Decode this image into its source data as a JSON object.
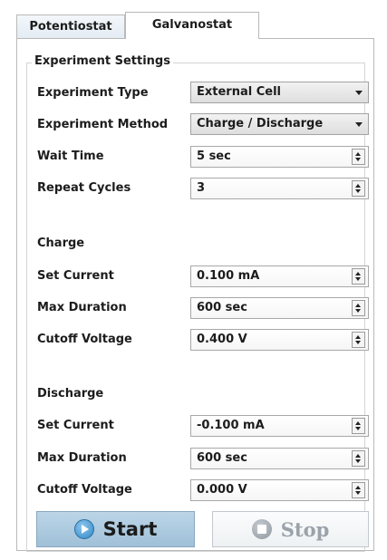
{
  "tabs": [
    "Potentiostat",
    "Galvanostat"
  ],
  "active_tab": "Galvanostat",
  "group_title": "Experiment Settings",
  "settings": {
    "experiment_type": {
      "label": "Experiment Type",
      "value": "External Cell"
    },
    "experiment_method": {
      "label": "Experiment Method",
      "value": "Charge / Discharge"
    },
    "wait_time": {
      "label": "Wait Time",
      "value": "5 sec"
    },
    "repeat_cycles": {
      "label": "Repeat Cycles",
      "value": "3"
    }
  },
  "charge": {
    "heading": "Charge",
    "set_current": {
      "label": "Set Current",
      "value": "0.100 mA"
    },
    "max_duration": {
      "label": "Max Duration",
      "value": "600 sec"
    },
    "cutoff_voltage": {
      "label": "Cutoff Voltage",
      "value": "0.400 V"
    }
  },
  "discharge": {
    "heading": "Discharge",
    "set_current": {
      "label": "Set Current",
      "value": "-0.100 mA"
    },
    "max_duration": {
      "label": "Max Duration",
      "value": "600 sec"
    },
    "cutoff_voltage": {
      "label": "Cutoff Voltage",
      "value": "0.000 V"
    }
  },
  "buttons": {
    "start": "Start",
    "stop": "Stop"
  },
  "icons": {
    "start": "play-icon",
    "stop": "stop-icon",
    "dropdown": "chevron-down-icon",
    "spinner": "spinner-arrows-icon"
  },
  "colors": {
    "start_button": "#a9c8de",
    "stop_text": "#9aa2aa",
    "border": "#b9b9b9"
  }
}
